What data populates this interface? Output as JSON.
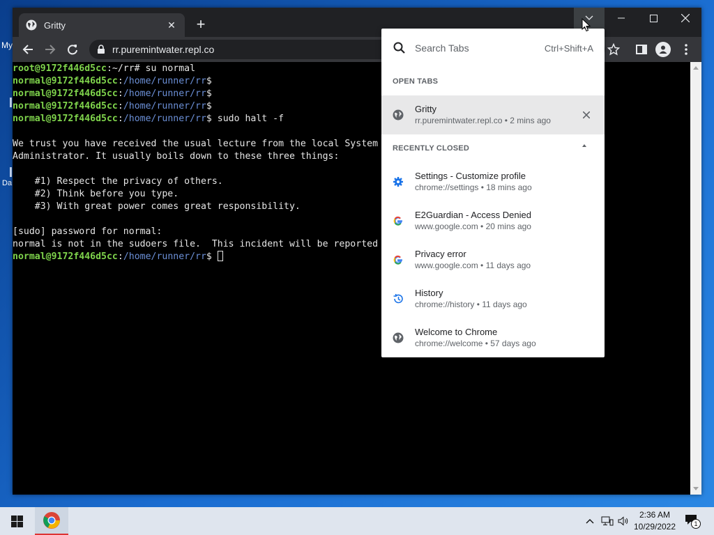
{
  "desktop": {
    "label1": "My",
    "label2": "Da"
  },
  "browser": {
    "tab_title": "Gritty",
    "url": "rr.puremintwater.repl.co"
  },
  "terminal": {
    "lines": [
      [
        {
          "t": "root@9172f446d5cc",
          "c": "g"
        },
        {
          "t": ":~/rr# su normal"
        }
      ],
      [
        {
          "t": "normal@9172f446d5cc",
          "c": "g"
        },
        {
          "t": ":"
        },
        {
          "t": "/home/runner/rr",
          "c": "b"
        },
        {
          "t": "$"
        }
      ],
      [
        {
          "t": "normal@9172f446d5cc",
          "c": "g"
        },
        {
          "t": ":"
        },
        {
          "t": "/home/runner/rr",
          "c": "b"
        },
        {
          "t": "$"
        }
      ],
      [
        {
          "t": "normal@9172f446d5cc",
          "c": "g"
        },
        {
          "t": ":"
        },
        {
          "t": "/home/runner/rr",
          "c": "b"
        },
        {
          "t": "$"
        }
      ],
      [
        {
          "t": "normal@9172f446d5cc",
          "c": "g"
        },
        {
          "t": ":"
        },
        {
          "t": "/home/runner/rr",
          "c": "b"
        },
        {
          "t": "$ sudo halt -f"
        }
      ],
      [
        {
          "t": ""
        }
      ],
      [
        {
          "t": "We trust you have received the usual lecture from the local System"
        }
      ],
      [
        {
          "t": "Administrator. It usually boils down to these three things:"
        }
      ],
      [
        {
          "t": ""
        }
      ],
      [
        {
          "t": "    #1) Respect the privacy of others."
        }
      ],
      [
        {
          "t": "    #2) Think before you type."
        }
      ],
      [
        {
          "t": "    #3) With great power comes great responsibility."
        }
      ],
      [
        {
          "t": ""
        }
      ],
      [
        {
          "t": "[sudo] password for normal:"
        }
      ],
      [
        {
          "t": "normal is not in the sudoers file.  This incident will be reported"
        }
      ],
      [
        {
          "t": "normal@9172f446d5cc",
          "c": "g"
        },
        {
          "t": ":"
        },
        {
          "t": "/home/runner/rr",
          "c": "b"
        },
        {
          "t": "$ "
        },
        {
          "t": "",
          "c": "cursor"
        }
      ]
    ]
  },
  "tab_search": {
    "placeholder": "Search Tabs",
    "shortcut": "Ctrl+Shift+A",
    "open_tabs_title": "OPEN TABS",
    "recently_closed_title": "RECENTLY CLOSED",
    "open_tabs": [
      {
        "title": "Gritty",
        "url": "rr.puremintwater.repl.co",
        "time": "2 mins ago",
        "icon": "globe-icon"
      }
    ],
    "recently_closed": [
      {
        "title": "Settings - Customize profile",
        "url": "chrome://settings",
        "time": "18 mins ago",
        "icon": "settings-gear-icon"
      },
      {
        "title": "E2Guardian - Access Denied",
        "url": "www.google.com",
        "time": "20 mins ago",
        "icon": "google-icon"
      },
      {
        "title": "Privacy error",
        "url": "www.google.com",
        "time": "11 days ago",
        "icon": "google-icon"
      },
      {
        "title": "History",
        "url": "chrome://history",
        "time": "11 days ago",
        "icon": "history-icon"
      },
      {
        "title": "Welcome to Chrome",
        "url": "chrome://welcome",
        "time": "57 days ago",
        "icon": "globe-icon"
      }
    ],
    "separator": " • "
  },
  "taskbar": {
    "time": "2:36 AM",
    "date": "10/29/2022",
    "notification_count": "1"
  }
}
